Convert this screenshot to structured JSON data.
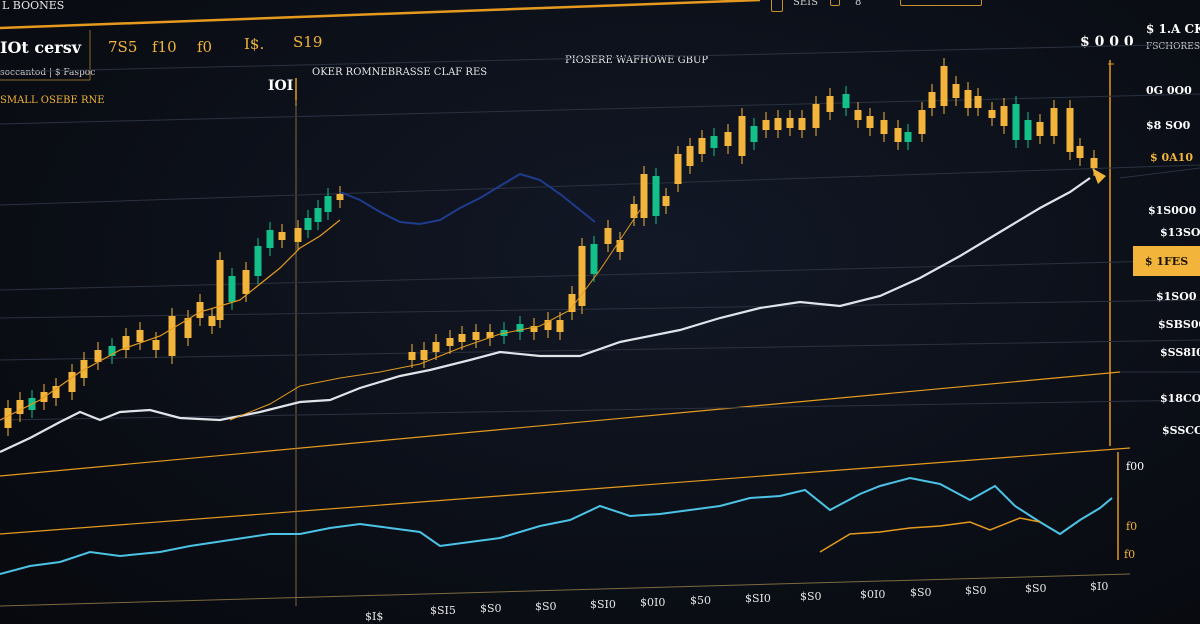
{
  "header": {
    "brand": "L BOONES",
    "top_controls": [
      "S",
      "SEIS",
      "8"
    ],
    "ticker_name": "IOt cersv",
    "sub_info": "soccantod | $ Faspoc",
    "stats": [
      "7S5",
      "f10",
      "f0",
      "I$.",
      "S19"
    ],
    "price_top": "$ 0 0 0",
    "pair_label": "$ 1.A CKP",
    "pair_sub": "FSCHORES"
  },
  "chart_header": {
    "marker": "IOI",
    "title": "OKER ROMNEBRASSE CLAF RES",
    "center_title": "PIOSERE WAFHOWE GBUP",
    "left_label": "SMALL OSEBE RNE"
  },
  "price_axis": [
    "0G 0O0",
    "$8 SO0",
    "$ 0A10",
    "$1S0O0",
    "$13SO0",
    "$1SO0",
    "$SBS00",
    "$SS8I00",
    "$18CO0",
    "$SSCO0",
    "$18CO0"
  ],
  "current_price_badge": "$ 1FES",
  "lower_axis": [
    "f00",
    "f0",
    "f0"
  ],
  "time_axis": [
    "$I$",
    "$SI5",
    "$S0",
    "$S0",
    "$SI0",
    "$0I0",
    "$50",
    "$SI0",
    "$S0",
    "$0I0",
    "$S0",
    "$S0",
    "$S0",
    "$I0"
  ],
  "colors": {
    "up": "#14c08a",
    "down": "#f2b43a",
    "accent": "#e59a1f",
    "line_white": "#dfe3ea",
    "line_cyan": "#4cc3e6",
    "line_navy": "#1f3b8c"
  }
}
